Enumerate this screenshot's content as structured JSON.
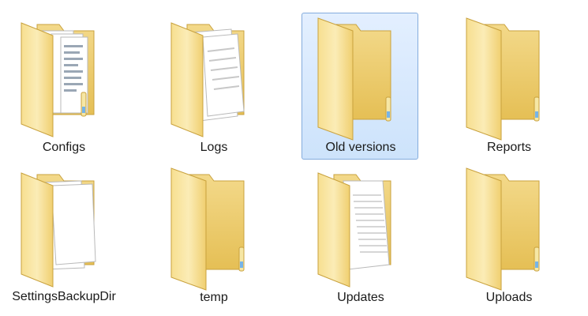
{
  "window": {
    "view": "Large icons"
  },
  "items": [
    {
      "label": "Configs",
      "icon": "folder-documents-icon",
      "selected": false
    },
    {
      "label": "Logs",
      "icon": "folder-pages-icon",
      "selected": false
    },
    {
      "label": "Old versions",
      "icon": "folder-empty-icon",
      "selected": true
    },
    {
      "label": "Reports",
      "icon": "folder-empty-icon",
      "selected": false
    },
    {
      "label": "SettingsBackupDir",
      "icon": "folder-pages-icon",
      "selected": false
    },
    {
      "label": "temp",
      "icon": "folder-empty-icon",
      "selected": false
    },
    {
      "label": "Updates",
      "icon": "folder-lined-page-icon",
      "selected": false
    },
    {
      "label": "Uploads",
      "icon": "folder-empty-icon",
      "selected": false
    }
  ],
  "colors": {
    "selection_fill": "#cde3fb",
    "selection_border": "#84acdd",
    "folder_light": "#fbe9a6",
    "folder_dark": "#e8c35c"
  }
}
